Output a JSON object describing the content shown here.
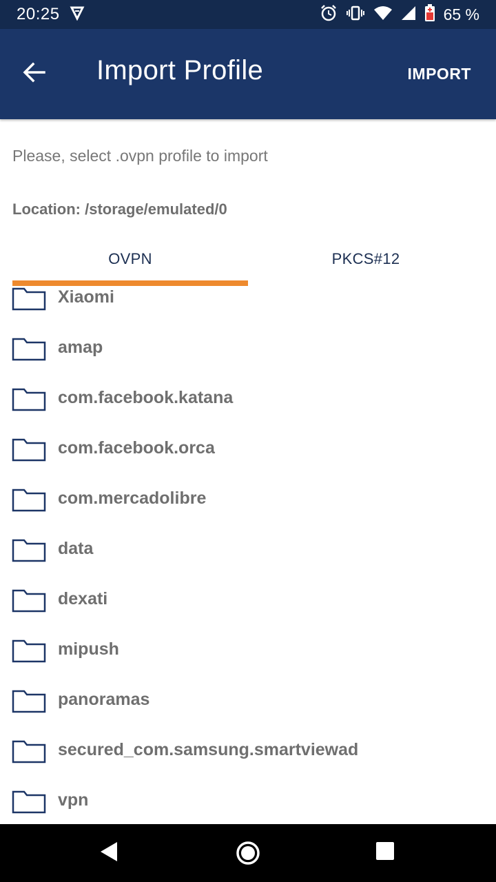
{
  "status_bar": {
    "time": "20:25",
    "battery_percent": "65 %",
    "icons": [
      "media-icon",
      "alarm-icon",
      "vibrate-icon",
      "wifi-icon",
      "signal-icon",
      "battery-icon"
    ]
  },
  "app_bar": {
    "title": "Import Profile",
    "action_label": "IMPORT",
    "back_icon": "arrow-back-icon"
  },
  "instruction": "Please, select .ovpn profile to import",
  "location_text": "Location: /storage/emulated/0",
  "tabs": [
    {
      "label": "OVPN",
      "selected": true
    },
    {
      "label": "PKCS#12",
      "selected": false
    }
  ],
  "files": [
    {
      "name": "Xiaomi",
      "icon": "folder-icon"
    },
    {
      "name": "amap",
      "icon": "folder-icon"
    },
    {
      "name": "com.facebook.katana",
      "icon": "folder-icon"
    },
    {
      "name": "com.facebook.orca",
      "icon": "folder-icon"
    },
    {
      "name": "com.mercadolibre",
      "icon": "folder-icon"
    },
    {
      "name": "data",
      "icon": "folder-icon"
    },
    {
      "name": "dexati",
      "icon": "folder-icon"
    },
    {
      "name": "mipush",
      "icon": "folder-icon"
    },
    {
      "name": "panoramas",
      "icon": "folder-icon"
    },
    {
      "name": "secured_com.samsung.smartviewad",
      "icon": "folder-icon"
    },
    {
      "name": "vpn",
      "icon": "folder-icon"
    }
  ],
  "nav_bar": {
    "icons": [
      "nav-back-icon",
      "nav-home-icon",
      "nav-recents-icon"
    ]
  },
  "colors": {
    "status_bar": "#142a4e",
    "app_bar": "#1b3668",
    "accent": "#ee8a2e",
    "folder_stroke": "#1c3566"
  }
}
